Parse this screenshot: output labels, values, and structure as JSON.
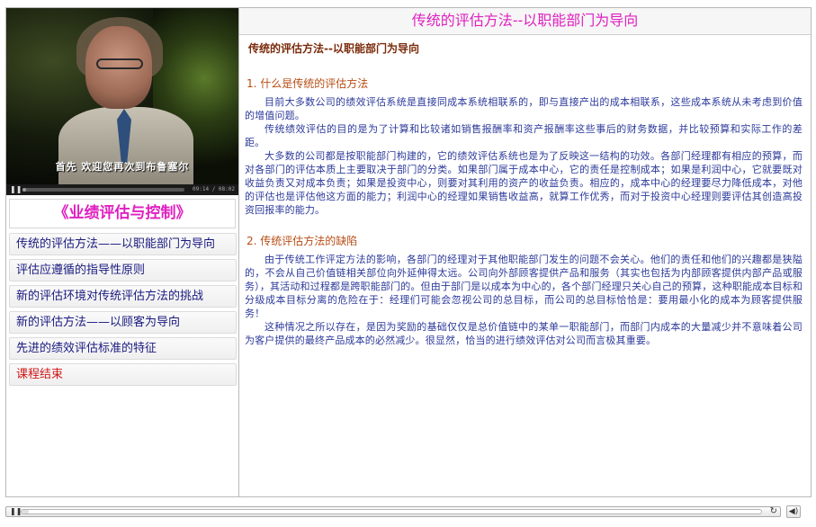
{
  "video": {
    "caption": "首先  欢迎您再次到布鲁塞尔",
    "time": "09:14 / 08:02",
    "progress": 0.02
  },
  "course_title": "《业绩评估与控制》",
  "menu": [
    {
      "label": "传统的评估方法——以职能部门为导向"
    },
    {
      "label": "评估应遵循的指导性原则"
    },
    {
      "label": "新的评估环境对传统评估方法的挑战"
    },
    {
      "label": "新的评估方法——以顾客为导向"
    },
    {
      "label": "先进的绩效评估标准的特征"
    },
    {
      "label": "课程结束"
    }
  ],
  "page": {
    "header": "传统的评估方法--以职能部门为导向",
    "subtitle": "传统的评估方法--以职能部门为导向",
    "section1": {
      "heading": "1. 什么是传统的评估方法",
      "paragraphs": [
        "目前大多数公司的绩效评估系统是直接同成本系统相联系的，即与直接产出的成本相联系，这些成本系统从未考虑到价值的增值问题。",
        "传统绩效评估的目的是为了计算和比较诸如销售报酬率和资产报酬率这些事后的财务数据，并比较预算和实际工作的差距。",
        "大多数的公司都是按职能部门构建的，它的绩效评估系统也是为了反映这一结构的功效。各部门经理都有相应的预算，而对各部门的评估本质上主要取决于部门的分类。如果部门属于成本中心，它的责任是控制成本；如果是利润中心，它就要既对收益负责又对成本负责；如果是投资中心，则要对其利用的资产的收益负责。相应的，成本中心的经理要尽力降低成本，对他的评估也是评估他这方面的能力；利润中心的经理如果销售收益高，就算工作优秀，而对于投资中心经理则要评估其创造高投资回报率的能力。"
      ]
    },
    "section2": {
      "heading": "2. 传统评估方法的缺陷",
      "paragraphs": [
        "由于传统工作评定方法的影响，各部门的经理对于其他职能部门发生的问题不会关心。他们的责任和他们的兴趣都是狭隘的，不会从自己价值链相关部位向外延伸得太远。公司向外部顾客提供产品和服务（其实也包括为内部顾客提供内部产品或服务），其活动和过程都是跨职能部门的。但由于部门是以成本为中心的，各个部门经理只关心自己的预算，这种职能成本目标和分级成本目标分离的危险在于：经理们可能会忽视公司的总目标，而公司的总目标恰恰是：要用最小化的成本为顾客提供服务！",
        "这种情况之所以存在，是因为奖励的基础仅仅是总价值链中的某单一职能部门，而部门内成本的大量减少并不意味着公司为客户提供的最终产品成本的必然减少。很显然，恰当的进行绩效评估对公司而言极其重要。"
      ]
    }
  },
  "player": {
    "progress": 0.01,
    "icons": [
      "pause-icon",
      "reload-icon",
      "speaker-icon"
    ]
  },
  "colors": {
    "accent": "#e020c0",
    "menu_text": "#1a1a80",
    "end_text": "#d01818",
    "body_text": "#2c3a9a",
    "heading_text": "#b84c14"
  }
}
